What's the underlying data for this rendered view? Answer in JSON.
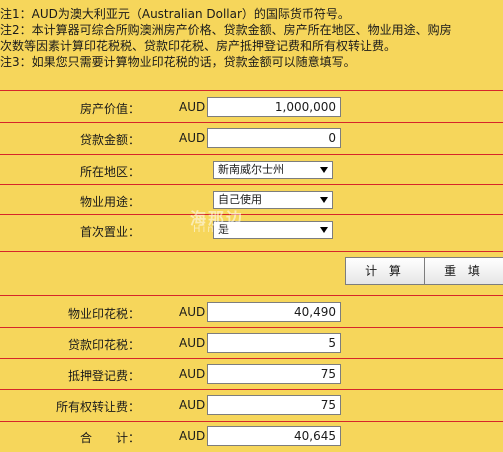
{
  "notes": [
    "注1：AUD为澳大利亚元（Australian Dollar）的国际货币符号。",
    "注2：本计算器可综合所购澳洲房产价格、贷款金额、房产所在地区、物业用途、购房",
    "次数等因素计算印花税税、贷款印花税、房产抵押登记费和所有权转让费。",
    "注3：如果您只需要计算物业印花税的话，贷款金额可以随意填写。"
  ],
  "currency": "AUD",
  "inputs": {
    "price_label": "房产价值：",
    "price_value": "1,000,000",
    "loan_label": "贷款金额：",
    "loan_value": "0",
    "region_label": "所在地区：",
    "region_value": "新南威尔士州",
    "usage_label": "物业用途：",
    "usage_value": "自己使用",
    "first_label": "首次置业：",
    "first_value": "是"
  },
  "buttons": {
    "calc": "计 算",
    "reset": "重 填"
  },
  "watermark": {
    "cn": "海那边",
    "en": "Hinabian"
  },
  "results": {
    "stamp_label": "物业印花税：",
    "stamp_value": "40,490",
    "loan_stamp_label": "贷款印花税：",
    "loan_stamp_value": "5",
    "mortgage_label": "抵押登记费：",
    "mortgage_value": "75",
    "transfer_label": "所有权转让费：",
    "transfer_value": "75",
    "total_label": "合　　计：",
    "total_value": "40,645"
  },
  "colors": {
    "background": "#f6d65b",
    "divider": "#d6262a"
  }
}
